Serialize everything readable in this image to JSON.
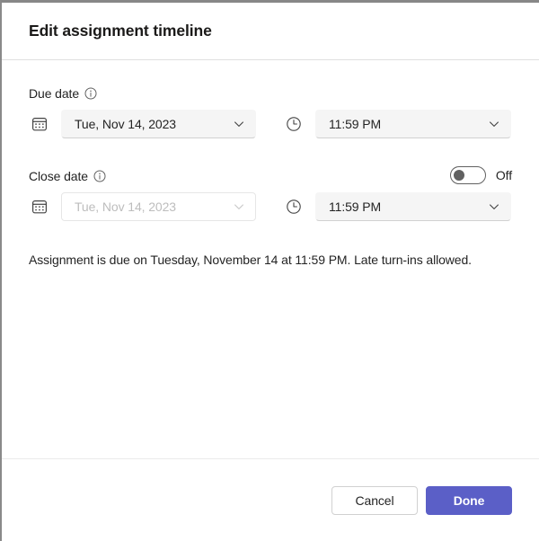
{
  "dialog": {
    "title": "Edit assignment timeline"
  },
  "due_date": {
    "label": "Due date",
    "info_icon": "info-circle-icon",
    "calendar_icon": "calendar-icon",
    "date_value": "Tue, Nov 14, 2023",
    "clock_icon": "clock-icon",
    "time_value": "11:59 PM",
    "chevron_icon": "chevron-down-icon"
  },
  "close_date": {
    "label": "Close date",
    "info_icon": "info-circle-icon",
    "calendar_icon": "calendar-icon",
    "date_value": "Tue, Nov 14, 2023",
    "clock_icon": "clock-icon",
    "time_value": "11:59 PM",
    "chevron_icon": "chevron-down-icon",
    "toggle_state": "Off"
  },
  "summary": {
    "text": "Assignment is due on Tuesday, November 14 at 11:59 PM. Late turn-ins allowed."
  },
  "footer": {
    "cancel_label": "Cancel",
    "done_label": "Done"
  },
  "colors": {
    "accent": "#5b5fc7",
    "field_background": "#f5f5f5",
    "text": "#242424",
    "disabled_text": "#bdbdbd"
  }
}
